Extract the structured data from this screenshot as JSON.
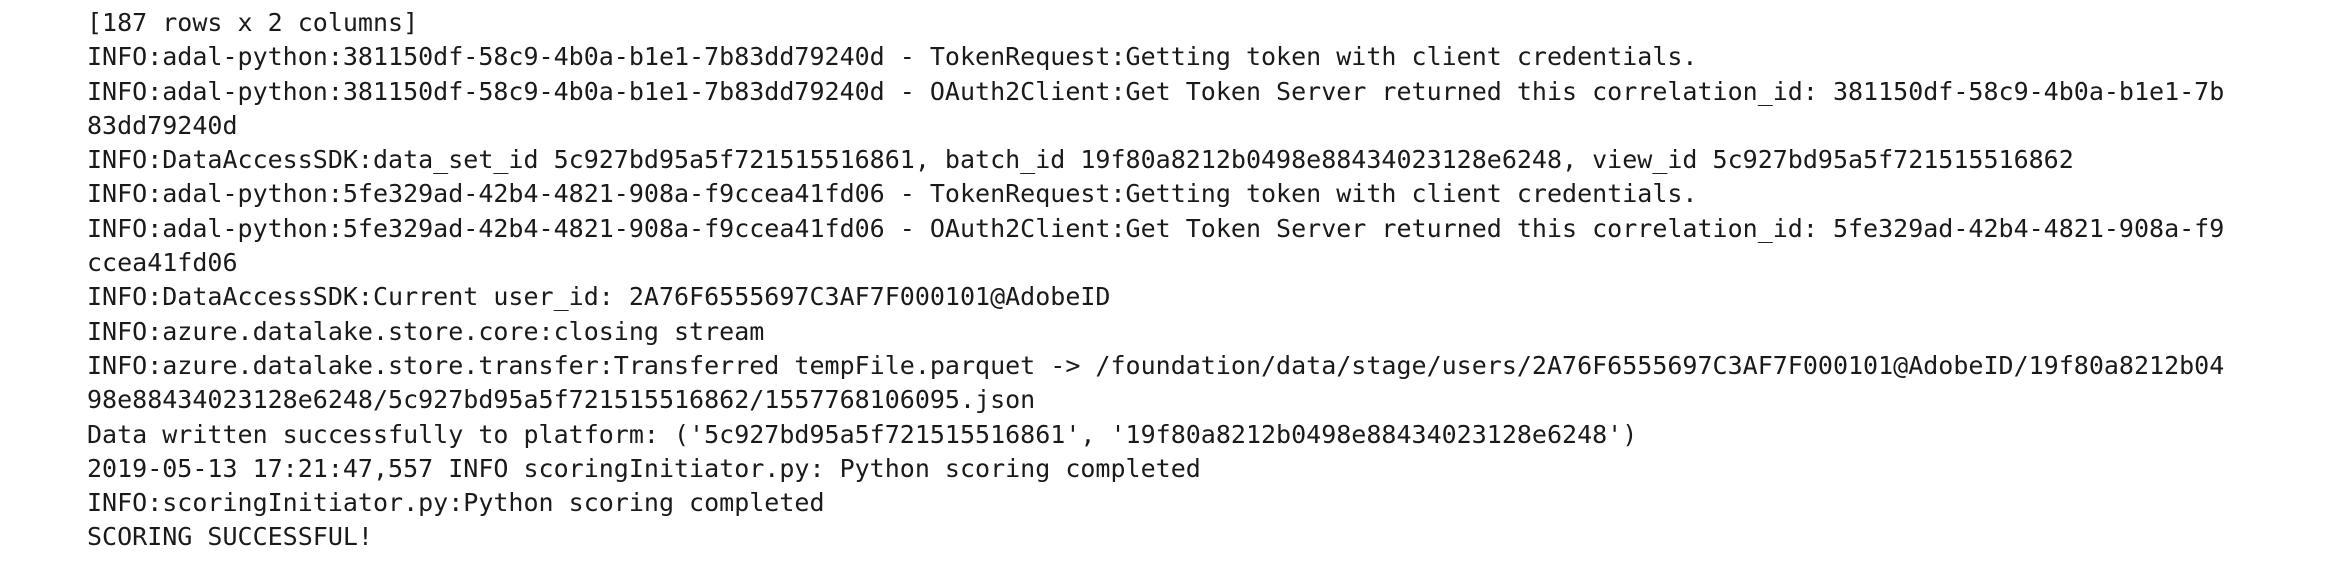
{
  "console": {
    "lines": [
      "[187 rows x 2 columns]",
      "INFO:adal-python:381150df-58c9-4b0a-b1e1-7b83dd79240d - TokenRequest:Getting token with client credentials.",
      "INFO:adal-python:381150df-58c9-4b0a-b1e1-7b83dd79240d - OAuth2Client:Get Token Server returned this correlation_id: 381150df-58c9-4b0a-b1e1-7b",
      "83dd79240d",
      "INFO:DataAccessSDK:data_set_id 5c927bd95a5f721515516861, batch_id 19f80a8212b0498e88434023128e6248, view_id 5c927bd95a5f721515516862",
      "INFO:adal-python:5fe329ad-42b4-4821-908a-f9ccea41fd06 - TokenRequest:Getting token with client credentials.",
      "INFO:adal-python:5fe329ad-42b4-4821-908a-f9ccea41fd06 - OAuth2Client:Get Token Server returned this correlation_id: 5fe329ad-42b4-4821-908a-f9",
      "ccea41fd06",
      "INFO:DataAccessSDK:Current user_id: 2A76F6555697C3AF7F000101@AdobeID",
      "INFO:azure.datalake.store.core:closing stream",
      "INFO:azure.datalake.store.transfer:Transferred tempFile.parquet -> /foundation/data/stage/users/2A76F6555697C3AF7F000101@AdobeID/19f80a8212b04",
      "98e88434023128e6248/5c927bd95a5f721515516862/1557768106095.json",
      "Data written successfully to platform: ('5c927bd95a5f721515516861', '19f80a8212b0498e88434023128e6248')",
      "2019-05-13 17:21:47,557 INFO scoringInitiator.py: Python scoring completed",
      "INFO:scoringInitiator.py:Python scoring completed",
      "SCORING SUCCESSFUL!"
    ]
  }
}
